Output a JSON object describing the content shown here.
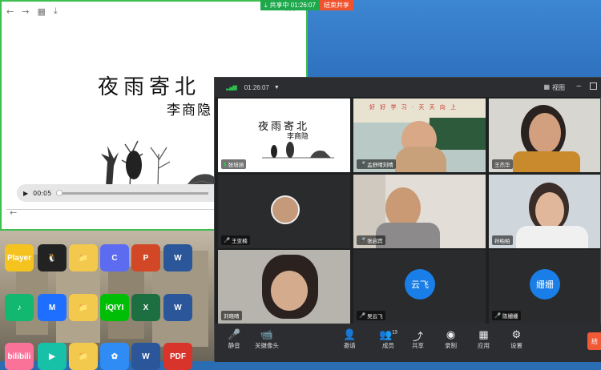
{
  "desktop": {
    "icons": [
      {
        "label": "Player",
        "glyph": "Player",
        "color": "#f5c320"
      },
      {
        "label": "QQ",
        "glyph": "🐧",
        "color": "#222"
      },
      {
        "label": "",
        "glyph": "📁",
        "color": "#f2c94c"
      },
      {
        "label": "",
        "glyph": "C",
        "color": "#5c6bf0"
      },
      {
        "label": "",
        "glyph": "P",
        "color": "#d24726"
      },
      {
        "label": "",
        "glyph": "W",
        "color": "#2b579a"
      },
      {
        "label": "",
        "glyph": "♪",
        "color": "#13b870"
      },
      {
        "label": "",
        "glyph": "M",
        "color": "#1e6fff"
      },
      {
        "label": "",
        "glyph": "📁",
        "color": "#f2c94c"
      },
      {
        "label": "",
        "glyph": "iQIYI",
        "color": "#00be06"
      },
      {
        "label": "",
        "glyph": "X",
        "color": "#1d6f42"
      },
      {
        "label": "",
        "glyph": "W",
        "color": "#2b579a"
      },
      {
        "label": "",
        "glyph": "bilibili",
        "color": "#fb7299"
      },
      {
        "label": "",
        "glyph": "▶",
        "color": "#16c1a8"
      },
      {
        "label": "",
        "glyph": "📁",
        "color": "#f2c94c"
      },
      {
        "label": "",
        "glyph": "✿",
        "color": "#2f8cf5"
      },
      {
        "label": "",
        "glyph": "W",
        "color": "#2b579a"
      },
      {
        "label": "",
        "glyph": "PDF",
        "color": "#d8342c"
      }
    ]
  },
  "share": {
    "status": "共享中 01:26:07",
    "stop": "结束共享"
  },
  "ppt": {
    "title": "夜雨寄北",
    "author": "李商隐",
    "video_time": "00:05"
  },
  "meeting": {
    "time": "01:26:07",
    "view_label": "视图",
    "tiles": [
      {
        "name": "张培涵"
      },
      {
        "name": "孟舒晴刘晴"
      },
      {
        "name": "王杰华"
      },
      {
        "name": "王亚楠"
      },
      {
        "name": "张启宾"
      },
      {
        "name": "孙柏柏"
      },
      {
        "name": "刘晓晴"
      },
      {
        "name": "吴云飞",
        "avatar": "云飞"
      },
      {
        "name": "陈姗姗",
        "avatar": "姗姗"
      }
    ],
    "controls": [
      {
        "label": "静音",
        "icon": "🎤"
      },
      {
        "label": "关摄像头",
        "icon": "📹"
      },
      {
        "label": "邀请",
        "icon": "👤"
      },
      {
        "label": "成员",
        "icon": "👥",
        "count": "13"
      },
      {
        "label": "共享",
        "icon": "⤴"
      },
      {
        "label": "录制",
        "icon": "◉"
      },
      {
        "label": "应用",
        "icon": "▦"
      },
      {
        "label": "设置",
        "icon": "⚙"
      }
    ],
    "end_label": "结"
  },
  "colors": {
    "share_green": "#1fa74c",
    "share_red": "#f0522e",
    "avatar_blue": "#1a7ee8"
  }
}
